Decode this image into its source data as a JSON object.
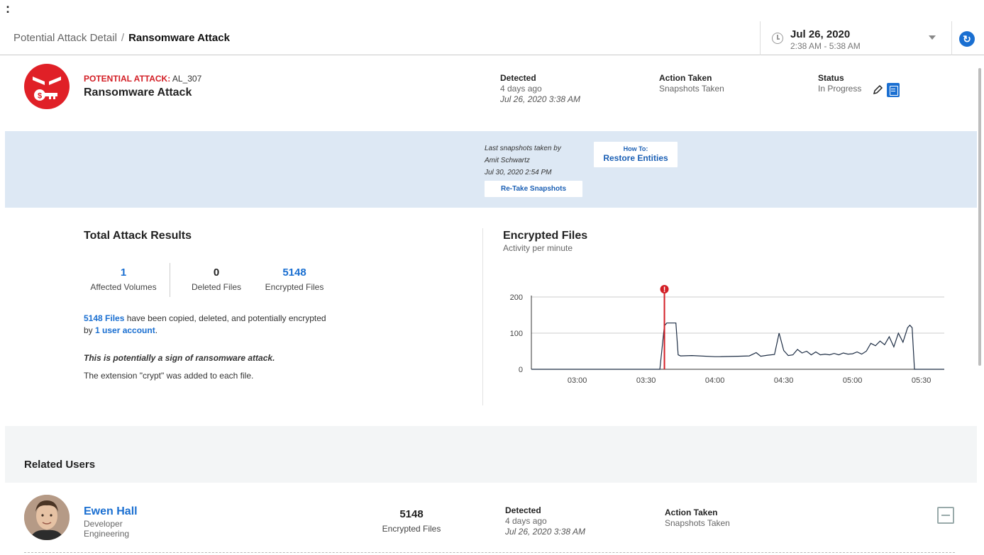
{
  "top_dots": ":",
  "header": {
    "breadcrumb_parent": "Potential Attack Detail",
    "breadcrumb_separator": "/",
    "breadcrumb_current": "Ransomware Attack",
    "date": "Jul 26, 2020",
    "time_range": "2:38 AM - 5:38 AM"
  },
  "attack": {
    "label_prefix": "POTENTIAL ATTACK:",
    "label_id": "AL_307",
    "title": "Ransomware Attack",
    "detected_label": "Detected",
    "detected_relative": "4 days ago",
    "detected_date": "Jul 26, 2020 3:38 AM",
    "action_label": "Action Taken",
    "action_value": "Snapshots Taken",
    "status_label": "Status",
    "status_value": "In Progress"
  },
  "snapshots": {
    "line1": "Last snapshots taken by",
    "line2": "Amit Schwartz",
    "line3": "Jul 30, 2020 2:54 PM",
    "retake_label": "Re-Take Snapshots",
    "howto_small": "How To:",
    "howto_label": "Restore Entities"
  },
  "results": {
    "title": "Total Attack Results",
    "stats": [
      {
        "value": "1",
        "label": "Affected Volumes"
      },
      {
        "value": "0",
        "label": "Deleted Files"
      },
      {
        "value": "5148",
        "label": "Encrypted Files"
      }
    ],
    "files_link": "5148 Files",
    "files_text": " have been copied, deleted, and potentially encrypted",
    "by_text": "by ",
    "user_link": "1 user account",
    "period": ".",
    "warning": "This is potentially a sign of ransomware attack.",
    "extension_note": "The extension \"crypt\" was added to each file."
  },
  "chart": {
    "title": "Encrypted Files",
    "subtitle": "Activity per minute"
  },
  "chart_data": {
    "type": "line",
    "title": "Encrypted Files",
    "subtitle": "Activity per minute",
    "xlabel": "",
    "ylabel": "",
    "x_ticks": [
      "03:00",
      "03:30",
      "04:00",
      "04:30",
      "05:00",
      "05:30"
    ],
    "y_ticks": [
      0,
      100,
      200
    ],
    "ylim": [
      0,
      200
    ],
    "xlim_minutes": [
      160,
      340
    ],
    "marker_time": "03:38",
    "series": [
      {
        "x_minutes": [
          160,
          216,
          217,
          218,
          219,
          220,
          223,
          224,
          225,
          230,
          240,
          242,
          250,
          255,
          258,
          260,
          263,
          266,
          268,
          270,
          272,
          274,
          276,
          278,
          280,
          282,
          284,
          286,
          288,
          290,
          292,
          294,
          296,
          298,
          300,
          302,
          304,
          306,
          308,
          310,
          312,
          314,
          316,
          318,
          320,
          322,
          324,
          325,
          326,
          327,
          340
        ],
        "values": [
          0,
          0,
          60,
          120,
          128,
          128,
          128,
          40,
          37,
          38,
          35,
          35,
          36,
          37,
          46,
          36,
          39,
          41,
          100,
          52,
          38,
          40,
          55,
          45,
          50,
          40,
          48,
          40,
          42,
          40,
          44,
          40,
          45,
          42,
          43,
          48,
          42,
          50,
          72,
          65,
          78,
          68,
          90,
          62,
          100,
          75,
          115,
          122,
          115,
          0,
          0
        ]
      }
    ],
    "grid": true,
    "colors": {
      "line": "#1d2d44",
      "marker": "#d31f26"
    }
  },
  "related_users": {
    "title": "Related Users",
    "user": {
      "name": "Ewen Hall",
      "role": "Developer",
      "department": "Engineering",
      "count": "5148",
      "count_label": "Encrypted Files",
      "detected_label": "Detected",
      "detected_relative": "4 days ago",
      "detected_date": "Jul 26, 2020 3:38 AM",
      "action_label": "Action Taken",
      "action_value": "Snapshots Taken"
    }
  }
}
